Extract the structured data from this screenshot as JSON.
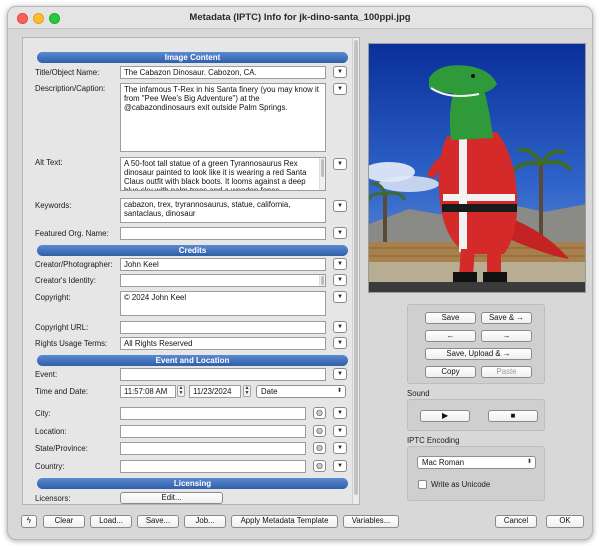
{
  "window": {
    "title": "Metadata (IPTC) Info for jk-dino-santa_100ppi.jpg"
  },
  "sections": {
    "image_content": "Image Content",
    "credits": "Credits",
    "event_location": "Event and Location",
    "licensing": "Licensing"
  },
  "image_content": {
    "title_label": "Title/Object Name:",
    "title_value": "The Cabazon Dinosaur. Cabozon, CA.",
    "description_label": "Description/Caption:",
    "description_value": "The infamous T-Rex in his Santa finery (you may know it from \"Pee Wee's Big Adventure\") at the @cabazondinosaurs exit outside Palm Springs.",
    "alt_label": "Alt Text:",
    "alt_value": "A 50-foot tall statue of a green Tyrannosaurus Rex dinosaur painted to look like it is wearing a red Santa Claus outfit with black boots. It looms against a deep blue sky with palm trees and a wooden fence.",
    "keywords_label": "Keywords:",
    "keywords_value": "cabazon, trex, tryrannosaurus, statue, california, santaclaus, dinosaur",
    "featured_label": "Featured Org. Name:",
    "featured_value": ""
  },
  "credits": {
    "creator_label": "Creator/Photographer:",
    "creator_value": "John Keel",
    "identity_label": "Creator's Identity:",
    "identity_value": "",
    "copyright_label": "Copyright:",
    "copyright_value": "© 2024 John Keel",
    "copyright_url_label": "Copyright URL:",
    "copyright_url_value": "",
    "rights_label": "Rights Usage Terms:",
    "rights_value": "All Rights Reserved"
  },
  "event": {
    "event_label": "Event:",
    "event_value": "",
    "time_label": "Time and Date:",
    "time_value": "11:57:08 AM",
    "date_value": "11/23/2024",
    "date_popup": "Date",
    "city_label": "City:",
    "city_value": "",
    "location_label": "Location:",
    "location_value": "",
    "state_label": "State/Province:",
    "state_value": "",
    "country_label": "Country:",
    "country_value": ""
  },
  "licensing": {
    "licensors_label": "Licensors:",
    "edit_button": "Edit..."
  },
  "actions": {
    "save": "Save",
    "save_next": "Save & →",
    "prev_arrow": "←",
    "next_arrow": "→",
    "save_upload": "Save, Upload & →",
    "copy": "Copy",
    "paste": "Paste"
  },
  "sound": {
    "title": "Sound",
    "play": "▶",
    "stop": "■"
  },
  "encoding": {
    "title": "IPTC Encoding",
    "selected": "Mac Roman",
    "unicode_label": "Write as Unicode",
    "unicode_checked": false
  },
  "bottom": {
    "lightning": "ϟ",
    "clear": "Clear",
    "load": "Load...",
    "save": "Save...",
    "job": "Job...",
    "apply": "Apply Metadata Template",
    "variables": "Variables...",
    "cancel": "Cancel",
    "ok": "OK"
  },
  "icons": {
    "dropdown": "chevron-down-icon",
    "globe": "globe-icon",
    "play": "play-icon",
    "stop": "stop-icon",
    "lightning": "lightning-icon"
  },
  "colors": {
    "section_header": "#3b6cba",
    "window_bg": "#d8d8d8",
    "panel_bg": "#e6e6e6"
  }
}
